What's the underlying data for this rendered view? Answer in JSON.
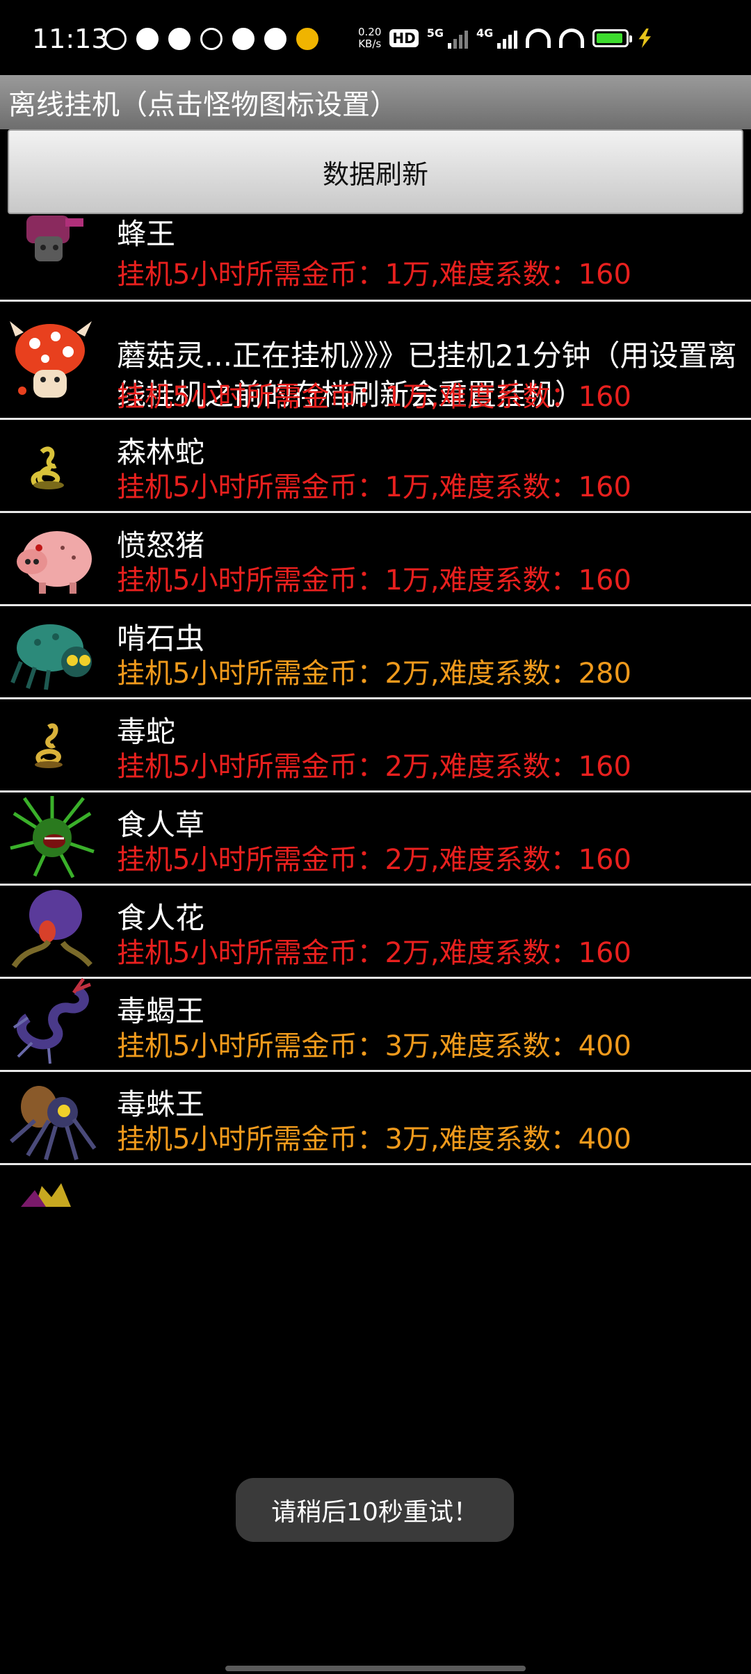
{
  "status": {
    "time": "11:13",
    "speed_value": "0.20",
    "speed_unit": "KB/s",
    "hd": "HD",
    "net1": "5G",
    "net2": "4G",
    "battery_level": 0.92
  },
  "title": "离线挂机（点击怪物图标设置）",
  "refresh_label": "数据刷新",
  "monsters": [
    {
      "name": "蜂王",
      "cost": "挂机5小时所需金币：1万,难度系数：160",
      "cost_color": "red",
      "icon": "bee-king-icon"
    },
    {
      "name": "蘑菇灵...正在挂机》》》已挂机21分钟（用设置离线挂机之前的存档刷新会重置挂机）",
      "cost": "挂机5小时所需金币：1万,难度系数：160",
      "cost_color": "red",
      "icon": "mushroom-spirit-icon"
    },
    {
      "name": "森林蛇",
      "cost": "挂机5小时所需金币：1万,难度系数：160",
      "cost_color": "red",
      "icon": "forest-snake-icon"
    },
    {
      "name": "愤怒猪",
      "cost": "挂机5小时所需金币：1万,难度系数：160",
      "cost_color": "red",
      "icon": "angry-pig-icon"
    },
    {
      "name": "啃石虫",
      "cost": "挂机5小时所需金币：2万,难度系数：280",
      "cost_color": "orange",
      "icon": "stone-bug-icon"
    },
    {
      "name": "毒蛇",
      "cost": "挂机5小时所需金币：2万,难度系数：160",
      "cost_color": "red",
      "icon": "viper-icon"
    },
    {
      "name": "食人草",
      "cost": "挂机5小时所需金币：2万,难度系数：160",
      "cost_color": "red",
      "icon": "maneater-grass-icon"
    },
    {
      "name": "食人花",
      "cost": "挂机5小时所需金币：2万,难度系数：160",
      "cost_color": "red",
      "icon": "maneater-flower-icon"
    },
    {
      "name": "毒蝎王",
      "cost": "挂机5小时所需金币：3万,难度系数：400",
      "cost_color": "orange",
      "icon": "scorpion-king-icon"
    },
    {
      "name": "毒蛛王",
      "cost": "挂机5小时所需金币：3万,难度系数：400",
      "cost_color": "orange",
      "icon": "spider-king-icon"
    }
  ],
  "toast": "请稍后10秒重试！",
  "colors": {
    "red": "#e8201e",
    "orange": "#f09a1c"
  }
}
